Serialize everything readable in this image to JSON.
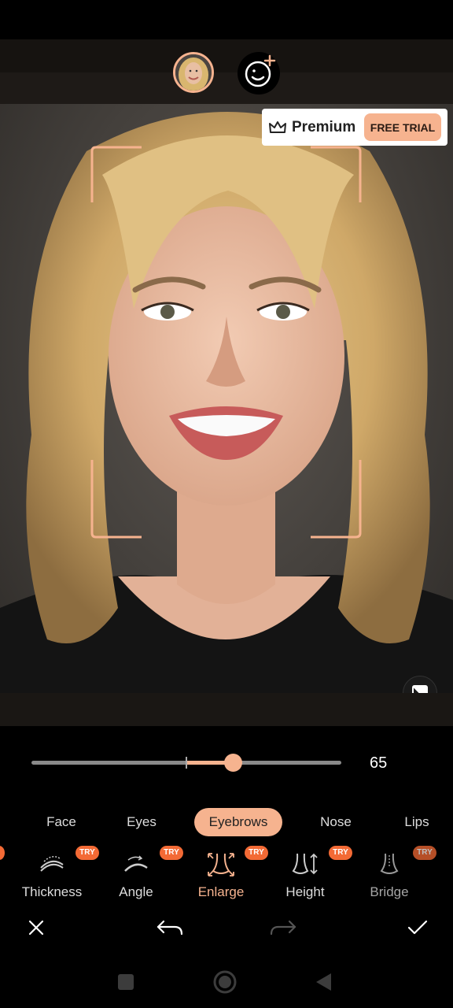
{
  "premium": {
    "label": "Premium",
    "free_trial": "FREE TRIAL"
  },
  "slider": {
    "value": "65",
    "level": 0.65,
    "midpoint": 0.5
  },
  "tabs": [
    {
      "label": "Face",
      "active": false
    },
    {
      "label": "Eyes",
      "active": false
    },
    {
      "label": "Eyebrows",
      "active": true
    },
    {
      "label": "Nose",
      "active": false
    },
    {
      "label": "Lips",
      "active": false
    }
  ],
  "tools": [
    {
      "label": "Thickness",
      "badge": "TRY",
      "icon": "eyebrow-thickness-icon",
      "active": false
    },
    {
      "label": "Angle",
      "badge": "TRY",
      "icon": "eyebrow-angle-icon",
      "active": false
    },
    {
      "label": "Enlarge",
      "badge": "TRY",
      "icon": "nose-enlarge-icon",
      "active": true
    },
    {
      "label": "Height",
      "badge": "TRY",
      "icon": "nose-height-icon",
      "active": false
    },
    {
      "label": "Bridge",
      "badge": "TRY",
      "icon": "nose-bridge-icon",
      "active": false
    }
  ],
  "colors": {
    "accent": "#f6b38f",
    "badge": "#f36a35",
    "background": "#000000"
  }
}
